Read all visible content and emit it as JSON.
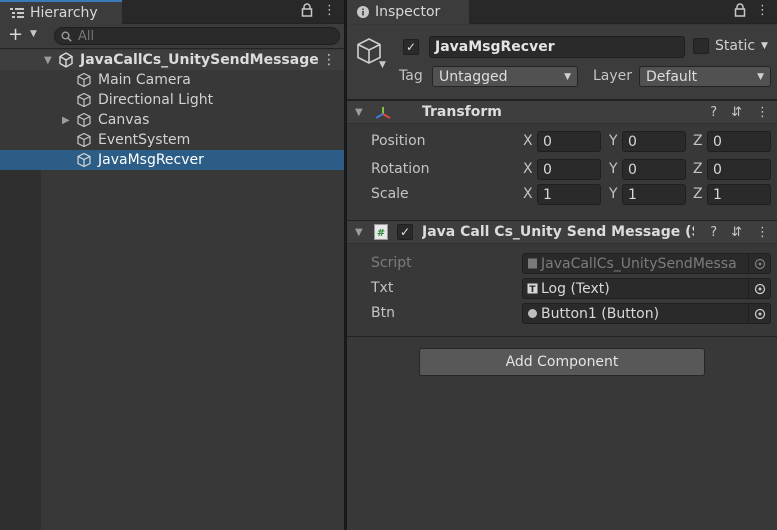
{
  "hierarchy": {
    "tab_title": "Hierarchy",
    "search_placeholder": "All",
    "scene_name": "JavaCallCs_UnitySendMessage",
    "items": [
      {
        "label": "Main Camera",
        "has_children": false,
        "selected": false
      },
      {
        "label": "Directional Light",
        "has_children": false,
        "selected": false
      },
      {
        "label": "Canvas",
        "has_children": true,
        "selected": false
      },
      {
        "label": "EventSystem",
        "has_children": false,
        "selected": false
      },
      {
        "label": "JavaMsgRecver",
        "has_children": false,
        "selected": true
      }
    ]
  },
  "inspector": {
    "tab_title": "Inspector",
    "object_name": "JavaMsgRecver",
    "static_label": "Static",
    "tag_label": "Tag",
    "tag_value": "Untagged",
    "layer_label": "Layer",
    "layer_value": "Default",
    "transform": {
      "title": "Transform",
      "rows": [
        {
          "label": "Position",
          "x": "0",
          "y": "0",
          "z": "0"
        },
        {
          "label": "Rotation",
          "x": "0",
          "y": "0",
          "z": "0"
        },
        {
          "label": "Scale",
          "x": "1",
          "y": "1",
          "z": "1"
        }
      ],
      "axes": [
        "X",
        "Y",
        "Z"
      ]
    },
    "script_component": {
      "title": "Java Call Cs_Unity Send Message (S",
      "fields": [
        {
          "label": "Script",
          "value": "JavaCallCs_UnitySendMessa",
          "icon": "script-icon",
          "disabled": true
        },
        {
          "label": "Txt",
          "value": "Log (Text)",
          "icon": "text-icon",
          "disabled": false
        },
        {
          "label": "Btn",
          "value": "Button1 (Button)",
          "icon": "button-icon",
          "disabled": false
        }
      ]
    },
    "add_component_label": "Add Component"
  },
  "colors": {
    "selection": "#2c5d87",
    "tab_accent": "#3a79bb",
    "panel_bg": "#383838"
  }
}
